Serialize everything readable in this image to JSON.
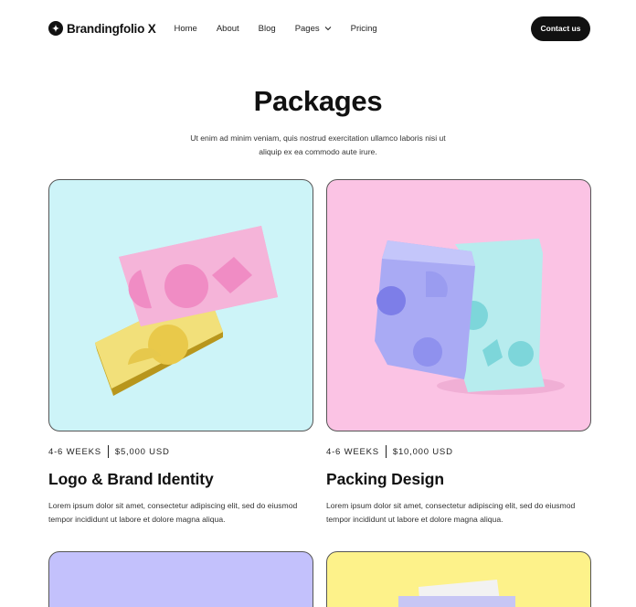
{
  "brand": {
    "name": "Brandingfolio X"
  },
  "nav": {
    "links": [
      {
        "label": "Home"
      },
      {
        "label": "About"
      },
      {
        "label": "Blog"
      },
      {
        "label": "Pages"
      },
      {
        "label": "Pricing"
      }
    ],
    "cta": "Contact us"
  },
  "hero": {
    "title": "Packages",
    "subtitle": "Ut enim ad minim veniam, quis nostrud exercitation ullamco laboris nisi ut aliquip ex ea commodo aute irure."
  },
  "packages": [
    {
      "duration": "4-6 WEEKS",
      "price": "$5,000 USD",
      "title": "Logo & Brand Identity",
      "description": "Lorem ipsum dolor sit amet, consectetur adipiscing elit, sed do eiusmod tempor incididunt ut labore et dolore magna aliqua.",
      "bg_color": "#cdf4f8"
    },
    {
      "duration": "4-6 WEEKS",
      "price": "$10,000 USD",
      "title": "Packing Design",
      "description": "Lorem ipsum dolor sit amet, consectetur adipiscing elit, sed do eiusmod tempor incididunt ut labore et dolore magna aliqua.",
      "bg_color": "#fbc3e4"
    },
    {
      "bg_color": "#c3c1fc"
    },
    {
      "bg_color": "#fdf28a"
    }
  ],
  "icons": {
    "logo": "sparkle-logo-icon",
    "pages_dropdown": "chevron-down-icon"
  }
}
